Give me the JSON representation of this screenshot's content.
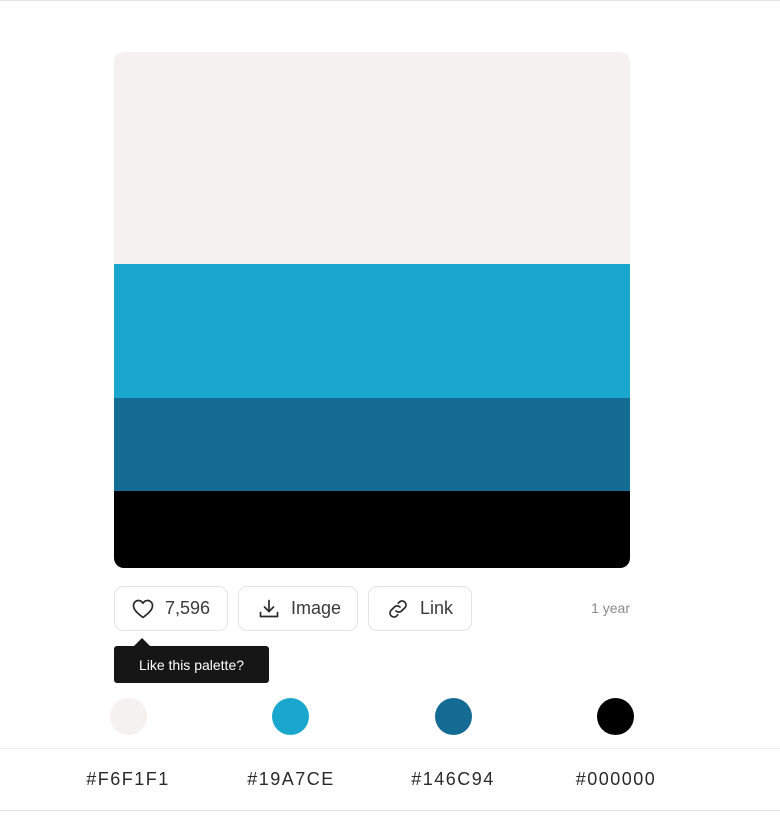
{
  "palette": {
    "colors": [
      {
        "hex": "#F6F1F1",
        "value": "#F6F1F1"
      },
      {
        "hex": "#19A7CE",
        "value": "#19A7CE"
      },
      {
        "hex": "#146C94",
        "value": "#146C94"
      },
      {
        "hex": "#000000",
        "value": "#000000"
      }
    ]
  },
  "actions": {
    "like_count": "7,596",
    "image_label": "Image",
    "link_label": "Link",
    "age": "1 year"
  },
  "tooltip": {
    "text": "Like this palette?"
  },
  "icons": {
    "like": "heart-icon",
    "image": "download-icon",
    "link": "link-icon"
  }
}
